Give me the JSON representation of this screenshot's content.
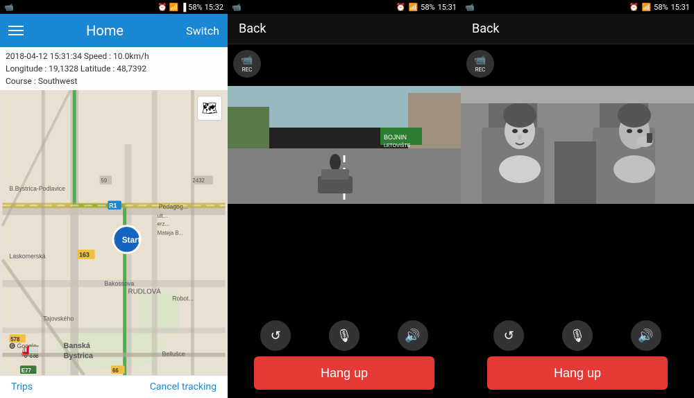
{
  "panel1": {
    "statusBar": {
      "time": "15:32",
      "battery": "58%",
      "network": "LTE"
    },
    "header": {
      "title": "Home",
      "switchLabel": "Switch",
      "menuIcon": "menu-icon"
    },
    "infoBar": {
      "line1": "2018-04-12  15:31:34   Speed : 10.0km/h",
      "line2": "Longitude : 19,1328   Latitude : 48,7392",
      "line3": "Course : Southwest"
    },
    "bottomBar": {
      "trips": "Trips",
      "cancelTracking": "Cancel tracking"
    },
    "mapLabels": [
      "B.Bystrica-Podlavice",
      "Laskomerská",
      "Banská Bystrica",
      "RUDLOVÁ",
      "Robotnícka"
    ],
    "roadNumbers": [
      "163",
      "R1",
      "E77",
      "66",
      "578"
    ]
  },
  "panel2": {
    "statusBar": {
      "time": "15:31",
      "battery": "58%"
    },
    "topBar": {
      "backLabel": "Back"
    },
    "recButton": {
      "label": "REC"
    },
    "controls": {
      "rotate": "↺",
      "mic": "🎙",
      "volume": "🔊"
    },
    "hangUp": "Hang up"
  },
  "panel3": {
    "statusBar": {
      "time": "15:31",
      "battery": "58%"
    },
    "topBar": {
      "backLabel": "Back"
    },
    "recButton": {
      "label": "REC"
    },
    "controls": {
      "rotate": "↺",
      "mic": "🎙",
      "volume": "🔊"
    },
    "hangUp": "Hang up"
  },
  "icons": {
    "camera": "📹",
    "menu": "☰",
    "rotate": "↺",
    "micOff": "🎙",
    "speaker": "🔊"
  },
  "colors": {
    "accent": "#1a87d4",
    "hangUp": "#e53935",
    "statusBar": "#000000",
    "headerBg": "#1a87d4"
  }
}
